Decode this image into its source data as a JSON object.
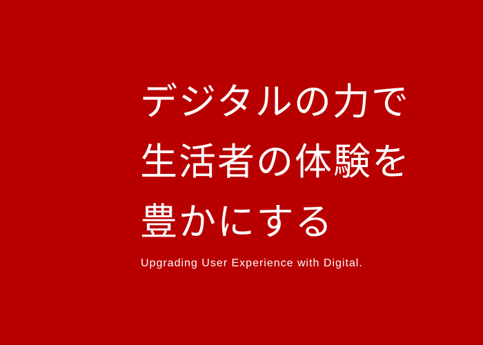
{
  "background_color": "#b80000",
  "text_color": "#ffffff",
  "headline": {
    "lines": [
      "デジタルの力で",
      "生活者の体験を",
      "豊かにする"
    ]
  },
  "tagline": "Upgrading User Experience with Digital."
}
